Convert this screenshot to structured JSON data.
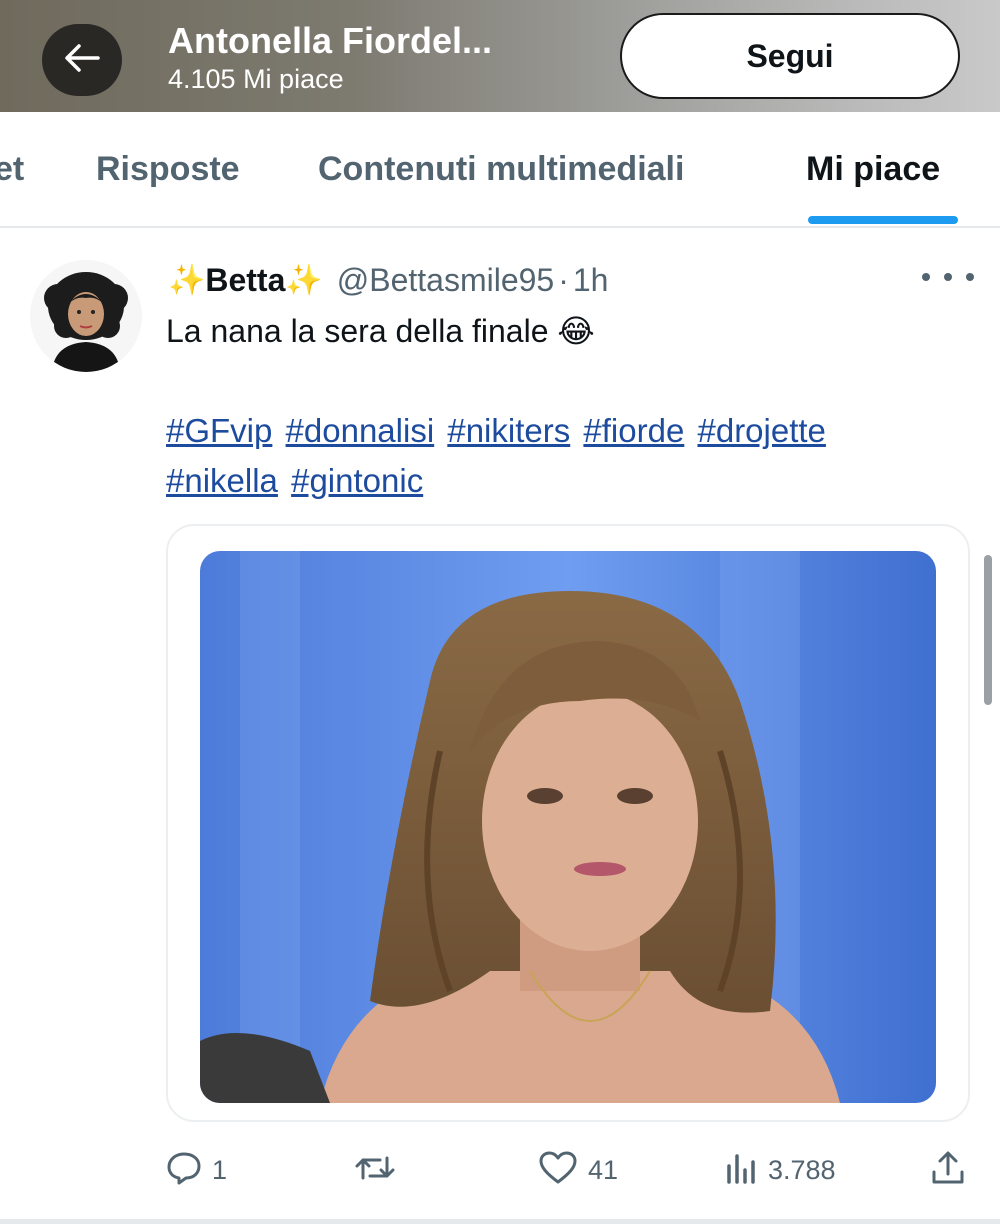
{
  "header": {
    "title": "Antonella Fiordel...",
    "subtitle": "4.105 Mi piace",
    "follow_label": "Segui",
    "back_icon": "arrow-left-icon"
  },
  "tabs": [
    {
      "label": "et",
      "active": false
    },
    {
      "label": "Risposte",
      "active": false
    },
    {
      "label": "Contenuti multimediali",
      "active": false
    },
    {
      "label": "Mi piace",
      "active": true
    }
  ],
  "tweet": {
    "name": "Betta",
    "name_decoration": "✨",
    "handle": "@Bettasmile95",
    "separator": "·",
    "time": "1h",
    "text": "La nana la sera della finale",
    "emoji": "😂",
    "hashtags_line1": [
      "#GFvip",
      "#donnalisi",
      "#nikiters",
      "#fiorde",
      "#drojette"
    ],
    "hashtags_line2": [
      "#nikella",
      "#gintonic"
    ],
    "actions": {
      "replies": "1",
      "retweets": "",
      "likes": "41",
      "views": "3.788"
    }
  },
  "colors": {
    "accent": "#1d9bf0",
    "hashtag": "#1d4b9e",
    "muted": "#536471",
    "text": "#0f1419"
  }
}
